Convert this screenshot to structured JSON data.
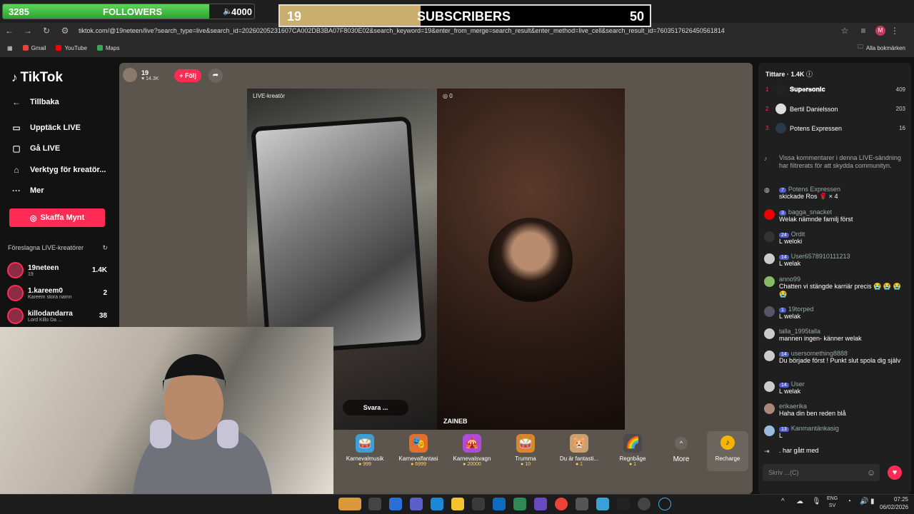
{
  "overlay": {
    "followers_current": "3285",
    "followers_label": "FOLLOWERS",
    "followers_goal": "4000",
    "followers_fraction": 0.82,
    "subs_current": "19",
    "subs_label": "SUBSCRIBERS",
    "subs_goal": "50",
    "subs_fraction": 0.38
  },
  "browser": {
    "url": "tiktok.com/@19neteen/live?search_type=live&search_id=20260205231607CA002DB3BA07F8030E02&search_keyword=19&enter_from_merge=search_result&enter_method=live_cell&search_result_id=7603517626450561814",
    "profile_initial": "M",
    "bookmarks": [
      "Gmail",
      "YouTube",
      "Maps"
    ],
    "all_bookmarks": "Alla bokmärken"
  },
  "sidebar": {
    "logo": "TikTok",
    "back": "Tillbaka",
    "items": [
      "Upptäck LIVE",
      "Gå LIVE",
      "Verktyg för kreatör...",
      "Mer"
    ],
    "coins_button": "Skaffa Mynt",
    "suggested_title": "Föreslagna LIVE-kreatörer",
    "creators": [
      {
        "name": "19neteen",
        "sub": "19",
        "count": "1.4K"
      },
      {
        "name": "1.kareem0",
        "sub": "Kareem stora namn",
        "count": "2"
      },
      {
        "name": "killodandarra",
        "sub": "Lord Killo Da ...",
        "count": "38"
      }
    ]
  },
  "stream": {
    "host_name": "19",
    "host_likes": "14.3K",
    "follow": "+ Följ",
    "live_creator_tag": "LIVE-kreatör",
    "opponent_score": "0",
    "opponent_name": "ZAINEB",
    "reply_label": "Svara ..."
  },
  "gifts": [
    {
      "name": "Karnevalmusik",
      "price": "999",
      "icon": "🥁",
      "color": "#3aa0d8"
    },
    {
      "name": "Karnevalfantasi",
      "price": "6999",
      "icon": "🎭",
      "color": "#e0702b"
    },
    {
      "name": "Karnevalsvagn",
      "price": "20000",
      "icon": "🎪",
      "color": "#b04ad8"
    },
    {
      "name": "Trumma",
      "price": "10",
      "icon": "🥁",
      "color": "#d8882b"
    },
    {
      "name": "Du är fantasti...",
      "price": "1",
      "icon": "🐹",
      "color": "#c9a070"
    },
    {
      "name": "Regnbåge",
      "price": "1",
      "icon": "🌈",
      "color": "#4a4a4a"
    }
  ],
  "gift_more": "More",
  "recharge": "Recharge",
  "chat": {
    "viewers_title": "Tittare · 1.4K",
    "top_viewers": [
      {
        "rank": "1",
        "name": "𝐒𝐮𝐩𝐞𝐫𝐬𝐨𝐧𝐢𝐜",
        "score": "409"
      },
      {
        "rank": "2",
        "name": "Bertil Danielsson",
        "score": "203"
      },
      {
        "rank": "3",
        "name": "Potens Expressen",
        "score": "16"
      }
    ],
    "messages": [
      {
        "user": "",
        "badge": "",
        "text": "Vissa kommentarer i denna LIVE-sändning har filtrerats för att skydda communityn.",
        "sys": true
      },
      {
        "user": "Potens Expressen",
        "badge": "7",
        "text": "skickade Ros 🌹 × 4"
      },
      {
        "user": "bagga_snacket",
        "badge": "3",
        "text": "Welak nämnde familj först"
      },
      {
        "user": "Ordit",
        "badge": "24",
        "text": "L weloki"
      },
      {
        "user": "User6578910111213",
        "badge": "14",
        "text": "L welak"
      },
      {
        "user": "anno99",
        "badge": "",
        "text": "Chatten vi stängde karriär precis 😭 😭 😭 😭"
      },
      {
        "user": "19torped",
        "badge": "1",
        "text": "L welak"
      },
      {
        "user": "talla_1995talla",
        "badge": "",
        "text": "mannen ingen- känner welak"
      },
      {
        "user": "usersomething8888",
        "badge": "14",
        "text": "Du började först ! Punkt slut spola dig själv"
      },
      {
        "user": "User",
        "badge": "14",
        "text": "L welak"
      },
      {
        "user": "erikaerika",
        "badge": "",
        "text": "Haha din ben reden blå"
      },
      {
        "user": "Kanmantänkasig",
        "badge": "13",
        "text": "L"
      },
      {
        "user": "",
        "badge": "",
        "text": ". har gått med",
        "sys": true
      }
    ],
    "input_placeholder": "Skriv ...(C)"
  },
  "taskbar": {
    "lang1": "ENG",
    "lang2": "SV",
    "time": "07:25",
    "date": "06/02/2026"
  }
}
